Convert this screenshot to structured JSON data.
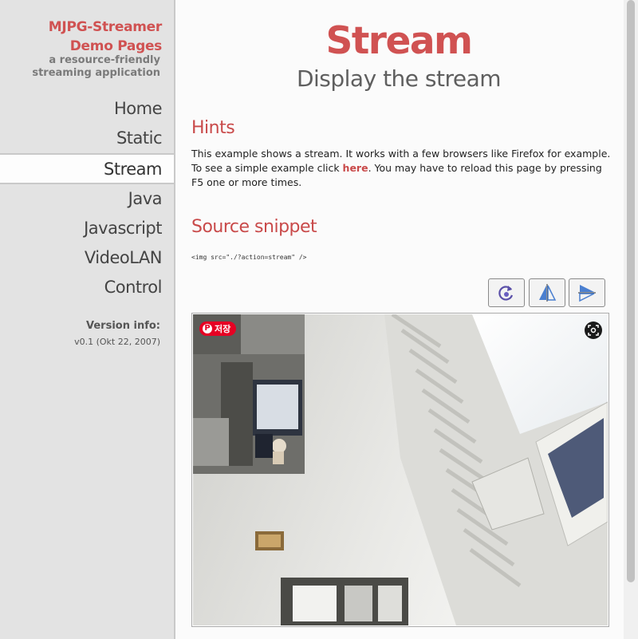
{
  "sidebar": {
    "brand_line1": "MJPG-Streamer",
    "brand_line2": "Demo Pages",
    "tagline": "a resource-friendly streaming application",
    "nav": [
      "Home",
      "Static",
      "Stream",
      "Java",
      "Javascript",
      "VideoLAN",
      "Control"
    ],
    "active": "Stream",
    "version_heading": "Version info:",
    "version_value": "v0.1 (Okt 22, 2007)"
  },
  "main": {
    "title": "Stream",
    "subtitle": "Display the stream",
    "hints_heading": "Hints",
    "hints_text_1": "This example shows a stream. It works with a few browsers like Firefox for example. To see a simple example click ",
    "hints_link": "here",
    "hints_text_2": ". You may have to reload this page by pressing F5 one or more times.",
    "source_heading": "Source snippet",
    "code_snippet": "<img src=\"./?action=stream\" />"
  },
  "controls": {
    "buttons": [
      "rotate-icon",
      "flip-vertical-icon",
      "flip-horizontal-icon"
    ]
  },
  "overlay": {
    "save_label": "저장",
    "pin_glyph": "P"
  },
  "colors": {
    "accent": "#d05252",
    "sidebar_bg": "#e3e3e3",
    "pinterest": "#e60023"
  }
}
